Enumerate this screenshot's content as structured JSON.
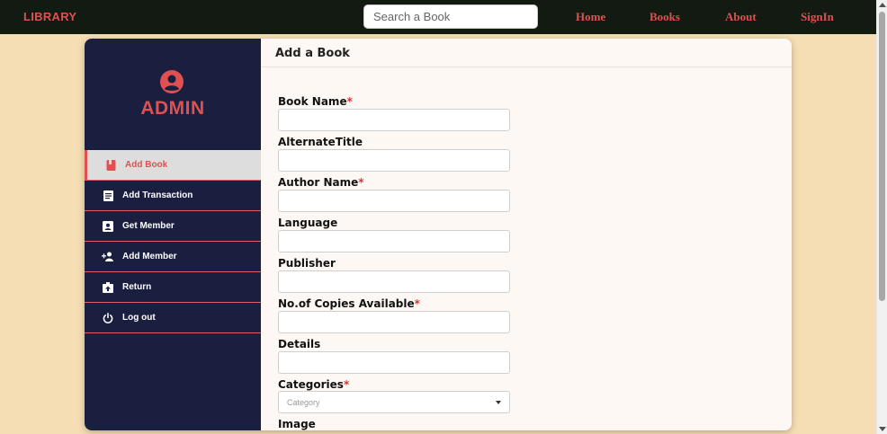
{
  "header": {
    "brand": "LIBRARY",
    "search_placeholder": "Search a Book",
    "nav": [
      "Home",
      "Books",
      "About",
      "SignIn"
    ]
  },
  "sidebar": {
    "role": "ADMIN",
    "items": [
      {
        "label": "Add Book",
        "icon": "book-icon",
        "active": true
      },
      {
        "label": "Add Transaction",
        "icon": "receipt-icon",
        "active": false
      },
      {
        "label": "Get Member",
        "icon": "contact-card-icon",
        "active": false
      },
      {
        "label": "Add Member",
        "icon": "add-person-icon",
        "active": false
      },
      {
        "label": "Return",
        "icon": "return-box-icon",
        "active": false
      },
      {
        "label": "Log out",
        "icon": "power-icon",
        "active": false
      }
    ]
  },
  "form": {
    "title": "Add a Book",
    "fields": [
      {
        "label": "Book Name",
        "required": "*",
        "value": ""
      },
      {
        "label": "AlternateTitle",
        "required": "",
        "value": ""
      },
      {
        "label": "Author Name",
        "required": "*",
        "value": ""
      },
      {
        "label": "Language",
        "required": "",
        "value": ""
      },
      {
        "label": "Publisher",
        "required": "",
        "value": ""
      },
      {
        "label": "No.of Copies Available",
        "required": "*",
        "value": ""
      },
      {
        "label": "Details",
        "required": "",
        "value": ""
      }
    ],
    "categories": {
      "label": "Categories",
      "required": "*",
      "placeholder": "Category"
    },
    "image": {
      "label": "Image"
    }
  },
  "colors": {
    "accent": "#e05050",
    "sidebar_bg": "#1a1f40",
    "topbar_bg": "#121a12",
    "page_bg": "#f5deb3"
  }
}
